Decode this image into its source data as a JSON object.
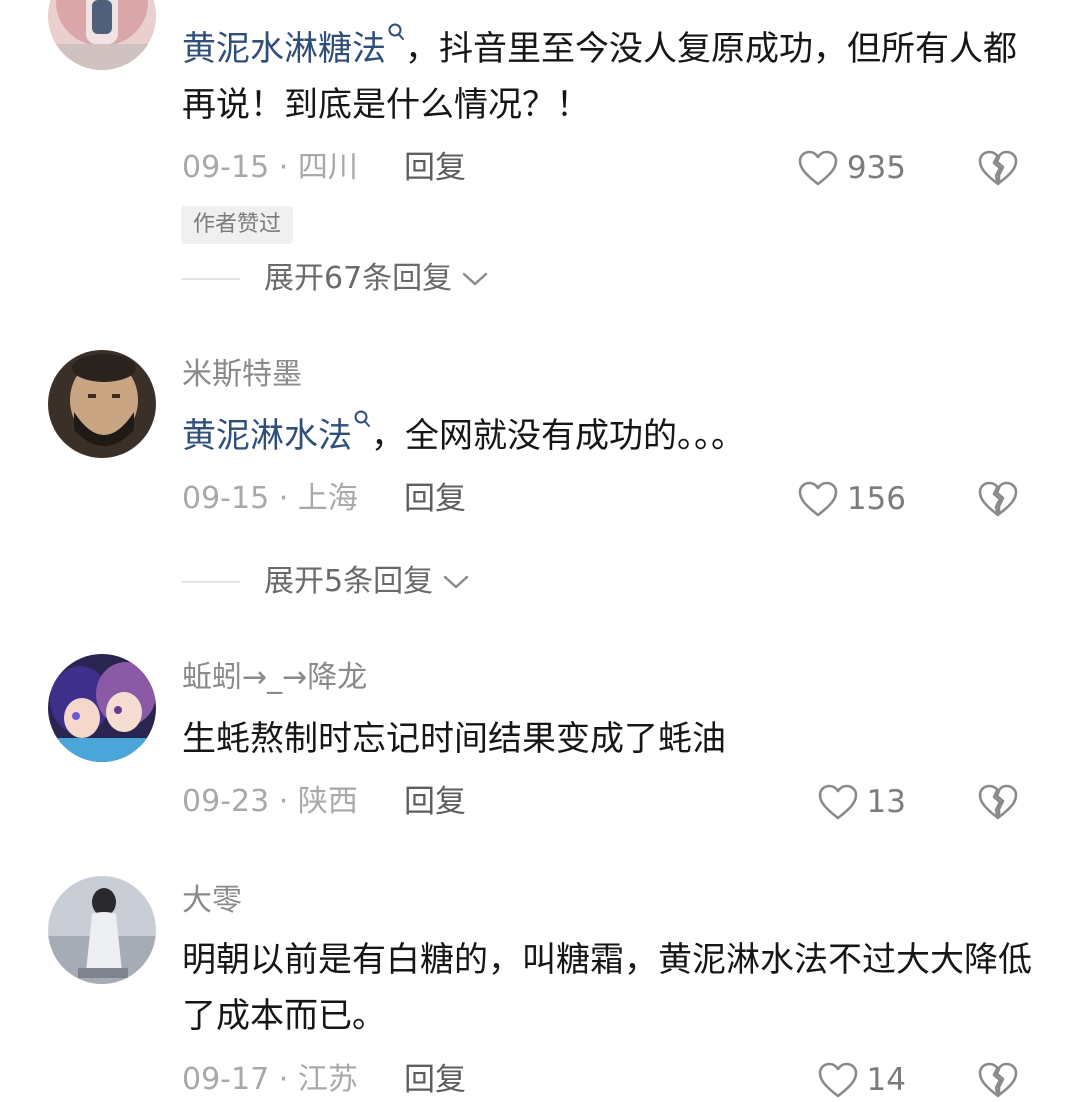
{
  "comments": [
    {
      "search_term": "黄泥水淋糖法",
      "text": "，抖音里至今没人复原成功，但所有人都再说！到底是什么情况？！",
      "date": "09-15",
      "separator": "·",
      "location": "四川",
      "reply_label": "回复",
      "likes": "935",
      "badge": "作者赞过",
      "expand_label": "展开67条回复"
    },
    {
      "username": "米斯特墨",
      "search_term": "黄泥淋水法",
      "text": "，全网就没有成功的。。。",
      "date": "09-15",
      "separator": "·",
      "location": "上海",
      "reply_label": "回复",
      "likes": "156",
      "expand_label": "展开5条回复"
    },
    {
      "username": "蚯蚓→_→降龙",
      "text": "生蚝熬制时忘记时间结果变成了蚝油",
      "date": "09-23",
      "separator": "·",
      "location": "陕西",
      "reply_label": "回复",
      "likes": "13"
    },
    {
      "username": "大零",
      "text": "明朝以前是有白糖的，叫糖霜，黄泥淋水法不过大大降低了成本而已。",
      "date": "09-17",
      "separator": "·",
      "location": "江苏",
      "reply_label": "回复",
      "likes": "14"
    }
  ],
  "icons": {
    "like": "heart-outline-icon",
    "dislike": "broken-heart-icon",
    "search": "search-icon",
    "chevron": "chevron-down-icon"
  },
  "colors": {
    "link": "#2f4e7a",
    "meta": "#a9a9a9",
    "username": "#8a8a8a",
    "text": "#161616"
  }
}
